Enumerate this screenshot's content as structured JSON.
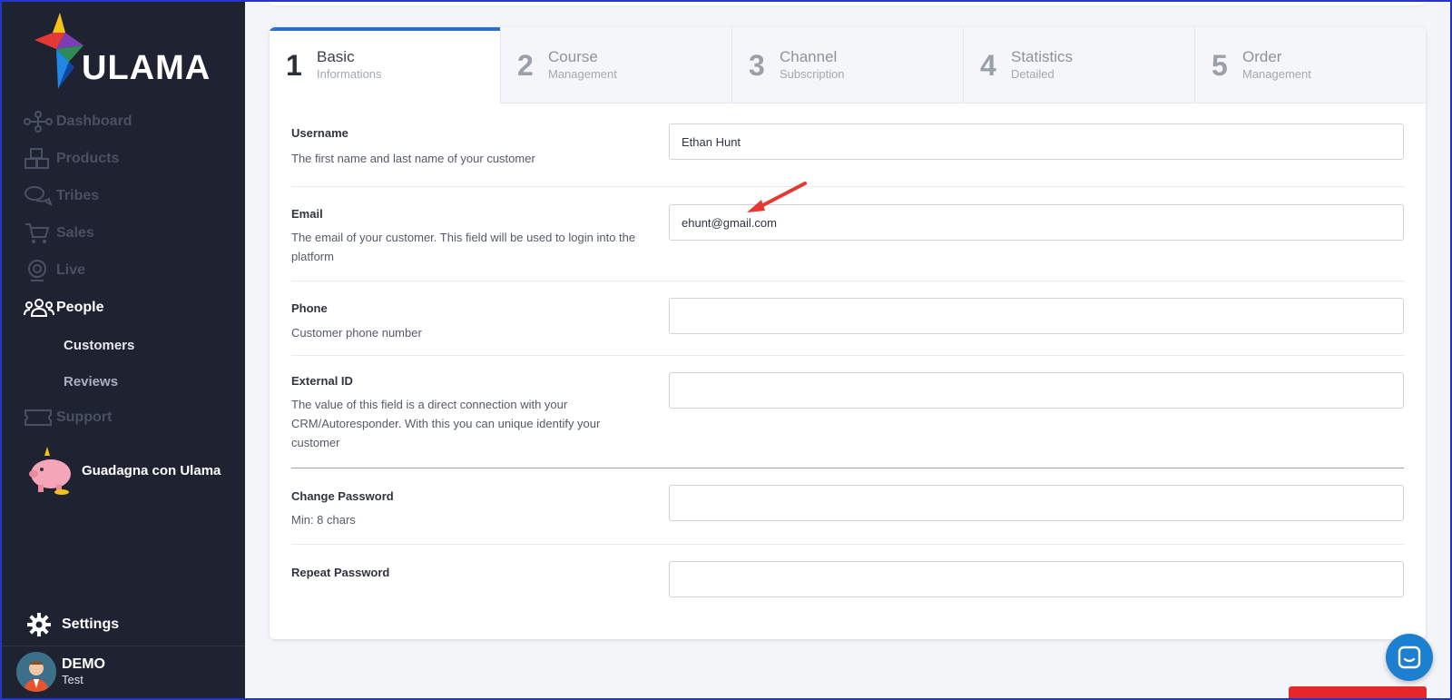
{
  "app": {
    "logo_text": "ULAMA"
  },
  "sidebar": {
    "items": [
      {
        "label": "Dashboard",
        "icon": "network-icon"
      },
      {
        "label": "Products",
        "icon": "boxes-icon"
      },
      {
        "label": "Tribes",
        "icon": "chat-bubbles-icon"
      },
      {
        "label": "Sales",
        "icon": "cart-icon"
      },
      {
        "label": "Live",
        "icon": "webcam-icon"
      },
      {
        "label": "People",
        "icon": "users-icon",
        "active": true
      },
      {
        "label": "Support",
        "icon": "ticket-icon"
      }
    ],
    "subitems": [
      {
        "label": "Customers",
        "active": true
      },
      {
        "label": "Reviews"
      }
    ],
    "promo": "Guadagna con Ulama",
    "settings": "Settings",
    "user": {
      "name": "DEMO",
      "role": "Test"
    }
  },
  "steps": [
    {
      "num": "1",
      "title": "Basic",
      "subtitle": "Informations",
      "active": true
    },
    {
      "num": "2",
      "title": "Course",
      "subtitle": "Management"
    },
    {
      "num": "3",
      "title": "Channel",
      "subtitle": "Subscription"
    },
    {
      "num": "4",
      "title": "Statistics",
      "subtitle": "Detailed"
    },
    {
      "num": "5",
      "title": "Order",
      "subtitle": "Management"
    }
  ],
  "form": {
    "username": {
      "label": "Username",
      "help": "The first name and last name of your customer",
      "value": "Ethan Hunt"
    },
    "email": {
      "label": "Email",
      "help": "The email of your customer. This field will be used to login into the platform",
      "value": "ehunt@gmail.com"
    },
    "phone": {
      "label": "Phone",
      "help": "Customer phone number",
      "value": ""
    },
    "external_id": {
      "label": "External ID",
      "help": "The value of this field is a direct connection with your CRM/Autoresponder. With this you can unique identify your customer",
      "value": ""
    },
    "change_password": {
      "label": "Change Password",
      "help": "Min: 8 chars",
      "value": ""
    },
    "repeat_password": {
      "label": "Repeat Password",
      "value": ""
    }
  },
  "colors": {
    "sidebar_bg": "#1f2230",
    "accent": "#2d6fcf",
    "annotation_arrow": "#e53935",
    "chat": "#1d7fd0"
  }
}
